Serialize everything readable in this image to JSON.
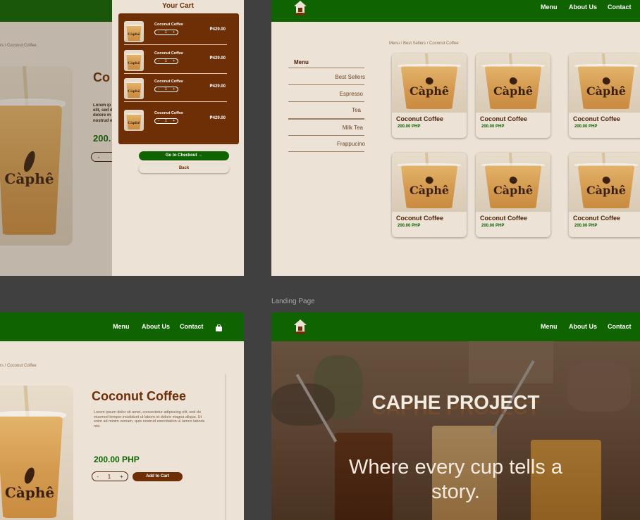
{
  "artboard_label": "Landing Page",
  "nav": {
    "menu": "Menu",
    "about": "About Us",
    "contact": "Contact"
  },
  "breadcrumb_partial": "rs / Coconut Coffee",
  "breadcrumb_full": "Menu  / Best Sellers / Coconut Coffee",
  "cup_brand": "Càphê",
  "product": {
    "title": "Coconut Coffee",
    "title_partial": "Co",
    "lorem": "Lorem ipsum dolor sit amet, consectetur adipiscing elit, sed do eiusmod tempor incididunt ut labore et dolore magna aliqua. Ut enim ad minim veniam, quis nostrud exercitation ul lamco laboris nisi.",
    "lorem_partial": "Lorem ip elit, sed d dolore m nostrud e",
    "price": "200.00 PHP",
    "price_partial": "200.",
    "qty": "1",
    "minus": "-",
    "plus": "+",
    "add_to_cart": "Add to Cart"
  },
  "cart": {
    "title": "Your Cart",
    "items": [
      {
        "name": "Coconut Coffee",
        "qty": "1",
        "price": "₱429.00"
      },
      {
        "name": "Coconut Coffee",
        "qty": "1",
        "price": "₱429.00"
      },
      {
        "name": "Coconut Coffee",
        "qty": "1",
        "price": "₱429.00"
      },
      {
        "name": "Coconut Coffee",
        "qty": "1",
        "price": "₱429.00"
      }
    ],
    "checkout": "Go to Checkout →",
    "back": "Back"
  },
  "menu_sidebar": {
    "heading": "Menu",
    "items": [
      "Best Sellers",
      "Espresso",
      "Tea",
      "Milk Tea",
      "Frappucino"
    ]
  },
  "grid": [
    {
      "name": "Coconut Coffee",
      "price": "200.00 PHP"
    },
    {
      "name": "Coconut Coffee",
      "price": "200.00 PHP"
    },
    {
      "name": "Coconut Coffee",
      "price": "200.00 PHP"
    },
    {
      "name": "Coconut Coffee",
      "price": "200.00 PHP"
    },
    {
      "name": "Coconut Coffee",
      "price": "200.00 PHP"
    },
    {
      "name": "Coconut Coffee",
      "price": "200.00 PHP"
    }
  ],
  "hero": {
    "title": "CAPHE PROJECT",
    "tagline_1": "Where every cup tells a",
    "tagline_2": "story."
  },
  "colors": {
    "nav_green": "#0f6300",
    "brown": "#6e2f07",
    "cream": "#ece3d6",
    "price_green": "#0f6300"
  },
  "icons": {
    "logo": "house-cup-logo",
    "cart": "shopping-bag-icon"
  }
}
